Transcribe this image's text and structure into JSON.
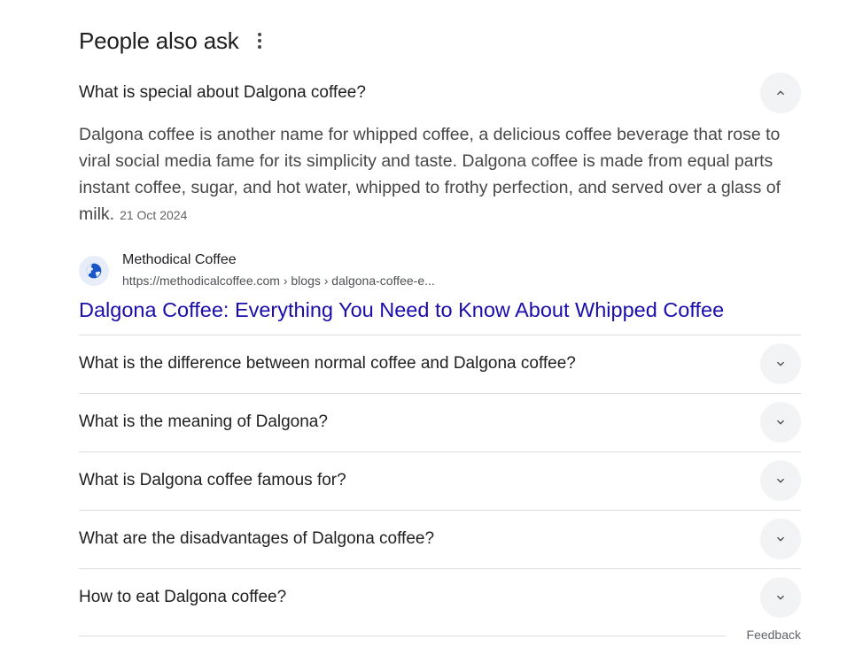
{
  "section": {
    "title": "People also ask"
  },
  "expanded": {
    "question": "What is special about Dalgona coffee?",
    "answer": "Dalgona coffee is another name for whipped coffee, a delicious coffee beverage that rose to viral social media fame for its simplicity and taste. Dalgona coffee is made from equal parts instant coffee, sugar, and hot water, whipped to frothy perfection, and served over a glass of milk.",
    "date": "21 Oct 2024",
    "source_name": "Methodical Coffee",
    "source_url": "https://methodicalcoffee.com › blogs › dalgona-coffee-e...",
    "link_title": "Dalgona Coffee: Everything You Need to Know About Whipped Coffee"
  },
  "questions": [
    "What is the difference between normal coffee and Dalgona coffee?",
    "What is the meaning of Dalgona?",
    "What is Dalgona coffee famous for?",
    "What are the disadvantages of Dalgona coffee?",
    "How to eat Dalgona coffee?"
  ],
  "footer": {
    "feedback_label": "Feedback"
  },
  "icons": {
    "more": "more-vert-icon",
    "expand": "chevron-down-icon",
    "collapse": "chevron-up-icon",
    "favicon": "globe-icon"
  },
  "colors": {
    "link": "#1a0dab",
    "chevron_bg": "#f1f3f4",
    "divider": "#dadce0"
  }
}
